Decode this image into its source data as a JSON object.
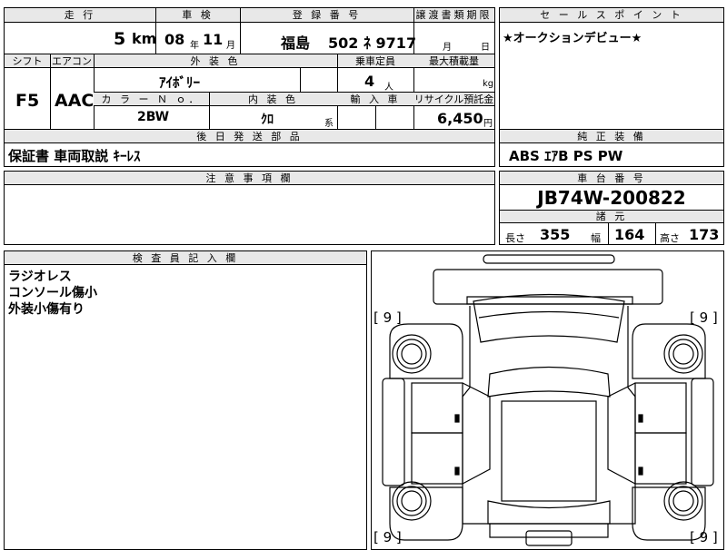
{
  "top": {
    "headers": {
      "mileage": "走 行",
      "inspection": "車 検",
      "plate": "登 録 番 号",
      "transfer": "譲渡書類期限",
      "shift": "シフト",
      "aircon": "エアコン",
      "exterior_color": "外 装 色",
      "capacity": "乗車定員",
      "max_load": "最大積載量",
      "color_no": "カ ラ ー Ｎ ｏ．",
      "interior_color": "内 装 色",
      "import": "輸 入 車",
      "recycle": "リサイクル預託金"
    },
    "mileage_value": "5",
    "mileage_unit": "km",
    "inspection_year": "08",
    "year_unit": "年",
    "inspection_month": "11",
    "month_unit": "月",
    "plate_region": "福島",
    "plate_number": "502 ﾈ 9717",
    "transfer_month": "月",
    "transfer_day": "日",
    "shift_value": "F5",
    "aircon_value": "AAC",
    "exterior_color_value": "ｱｲﾎﾞﾘｰ",
    "capacity_value": "4",
    "capacity_unit": "人",
    "load_unit": "kg",
    "color_no_value": "2BW",
    "interior_color_value": "ｸﾛ",
    "interior_suffix": "系",
    "recycle_value": "6,450",
    "recycle_unit": "円"
  },
  "sales_point": {
    "header": "セ ー ル ス ポ イ ン ト",
    "text": "★オークションデビュー★"
  },
  "delivery": {
    "header": "後 日 発 送 部 品",
    "text": "保証書 車両取説 ｷｰﾚｽ"
  },
  "equipment": {
    "header": "純 正 装 備",
    "text": "ABS ｴｱB PS PW"
  },
  "caution": {
    "header": "注 意 事 項 欄"
  },
  "chassis": {
    "header": "車 台 番 号",
    "number": "JB74W-200822",
    "spec_header": "諸 元",
    "length_label": "長さ",
    "length_value": "355",
    "width_label": "幅",
    "width_value": "164",
    "height_label": "高さ",
    "height_value": "173"
  },
  "inspector": {
    "header": "検 査 員 記 入 欄",
    "notes": [
      "ラジオレス",
      "コンソール傷小",
      "外装小傷有り"
    ]
  },
  "diagram": {
    "tire_labels": [
      "[ 9 ]",
      "[ 9 ]",
      "[ 9 ]",
      "[ 9 ]"
    ]
  }
}
